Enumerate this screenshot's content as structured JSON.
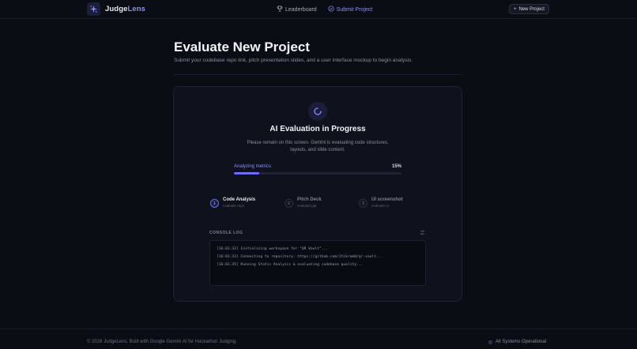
{
  "brand": {
    "name_prefix": "Judge",
    "name_suffix": "Lens"
  },
  "nav": {
    "leaderboard": "Leaderboard",
    "submit_project": "Submit Project"
  },
  "header_actions": {
    "new_project": "New Project"
  },
  "page": {
    "title": "Evaluate New Project",
    "subtitle": "Submit your codebase repo link, pitch presentation slides, and a user interface mockup to begin analysis."
  },
  "evaluation": {
    "title": "AI Evaluation in Progress",
    "description": "Please remain on this screen. Gemini is evaluating code structures, layouts, and slide content.",
    "progress_label": "Analyzing metrics",
    "progress_text": "15%",
    "progress_value": 0.15
  },
  "steps": [
    {
      "num": "1",
      "title": "Code Analysis",
      "sub": "evaluate repo",
      "active": true
    },
    {
      "num": "2",
      "title": "Pitch Deck",
      "sub": "evaluate ppt",
      "active": false
    },
    {
      "num": "3",
      "title": "UI screenshot",
      "sub": "evaluate ui",
      "active": false
    }
  ],
  "console": {
    "label": "CONSOLE LOG",
    "lines": [
      "[16:01:32] Initializing workspace for \"QR Vault\"...",
      "[16:01:33] Connecting to repository: https://github.com/Jtikram8/qr-vault...",
      "[16:01:35] Running Static Analysis & evaluating codebase quality..."
    ]
  },
  "footer": {
    "copyright": "© 2026 JudgeLens. Built with Google Gemini AI for Hackathon Judging.",
    "status": "All Systems Operational"
  },
  "colors": {
    "accent": "#8b8ff8",
    "background": "#0b0d14",
    "card": "#0f121c"
  },
  "icons": [
    "logo-icon",
    "trophy-icon",
    "submit-check-icon",
    "plus-icon",
    "spinner-icon",
    "console-settings-icon",
    "status-dot-icon"
  ]
}
